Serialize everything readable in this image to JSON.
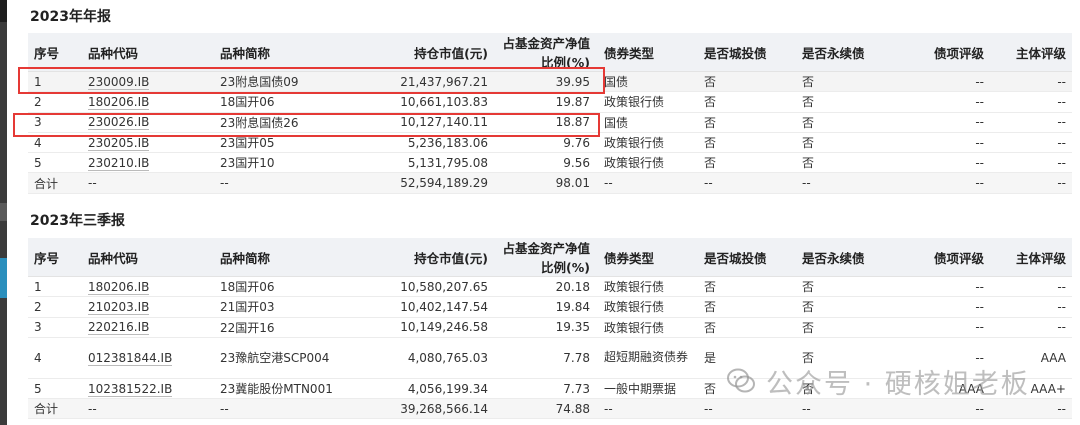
{
  "annual": {
    "title": "2023年年报",
    "headers": [
      "序号",
      "品种代码",
      "品种简称",
      "持仓市值(元)",
      "占基金资产净值比例(%)",
      "债券类型",
      "是否城投债",
      "是否永续债",
      "债项评级",
      "主体评级"
    ],
    "rows": [
      {
        "no": "1",
        "code": "230009.IB",
        "name": "23附息国债09",
        "value": "21,437,967.21",
        "pct": "39.95",
        "type": "国债",
        "city": "否",
        "perpetual": "否",
        "bond_rating": "--",
        "issuer_rating": "--"
      },
      {
        "no": "2",
        "code": "180206.IB",
        "name": "18国开06",
        "value": "10,661,103.83",
        "pct": "19.87",
        "type": "政策银行债",
        "city": "否",
        "perpetual": "否",
        "bond_rating": "--",
        "issuer_rating": "--"
      },
      {
        "no": "3",
        "code": "230026.IB",
        "name": "23附息国债26",
        "value": "10,127,140.11",
        "pct": "18.87",
        "type": "国债",
        "city": "否",
        "perpetual": "否",
        "bond_rating": "--",
        "issuer_rating": "--"
      },
      {
        "no": "4",
        "code": "230205.IB",
        "name": "23国开05",
        "value": "5,236,183.06",
        "pct": "9.76",
        "type": "政策银行债",
        "city": "否",
        "perpetual": "否",
        "bond_rating": "--",
        "issuer_rating": "--"
      },
      {
        "no": "5",
        "code": "230210.IB",
        "name": "23国开10",
        "value": "5,131,795.08",
        "pct": "9.56",
        "type": "政策银行债",
        "city": "否",
        "perpetual": "否",
        "bond_rating": "--",
        "issuer_rating": "--"
      }
    ],
    "total": {
      "no": "合计",
      "code": "--",
      "name": "--",
      "value": "52,594,189.29",
      "pct": "98.01",
      "type": "--",
      "city": "--",
      "perpetual": "--",
      "bond_rating": "--",
      "issuer_rating": "--"
    }
  },
  "q3": {
    "title": "2023年三季报",
    "headers": [
      "序号",
      "品种代码",
      "品种简称",
      "持仓市值(元)",
      "占基金资产净值比例(%)",
      "债券类型",
      "是否城投债",
      "是否永续债",
      "债项评级",
      "主体评级"
    ],
    "rows": [
      {
        "no": "1",
        "code": "180206.IB",
        "name": "18国开06",
        "value": "10,580,207.65",
        "pct": "20.18",
        "type": "政策银行债",
        "city": "否",
        "perpetual": "否",
        "bond_rating": "--",
        "issuer_rating": "--"
      },
      {
        "no": "2",
        "code": "210203.IB",
        "name": "21国开03",
        "value": "10,402,147.54",
        "pct": "19.84",
        "type": "政策银行债",
        "city": "否",
        "perpetual": "否",
        "bond_rating": "--",
        "issuer_rating": "--"
      },
      {
        "no": "3",
        "code": "220216.IB",
        "name": "22国开16",
        "value": "10,149,246.58",
        "pct": "19.35",
        "type": "政策银行债",
        "city": "否",
        "perpetual": "否",
        "bond_rating": "--",
        "issuer_rating": "--"
      },
      {
        "no": "4",
        "code": "012381844.IB",
        "name": "23豫航空港SCP004",
        "value": "4,080,765.03",
        "pct": "7.78",
        "type": "超短期融资债券",
        "city": "是",
        "perpetual": "否",
        "bond_rating": "--",
        "issuer_rating": "AAA"
      },
      {
        "no": "5",
        "code": "102381522.IB",
        "name": "23冀能股份MTN001",
        "value": "4,056,199.34",
        "pct": "7.73",
        "type": "一般中期票据",
        "city": "否",
        "perpetual": "否",
        "bond_rating": "AAA",
        "issuer_rating": "AAA+"
      }
    ],
    "total": {
      "no": "合计",
      "code": "--",
      "name": "--",
      "value": "39,268,566.14",
      "pct": "74.88",
      "type": "--",
      "city": "--",
      "perpetual": "--",
      "bond_rating": "--",
      "issuer_rating": "--"
    }
  },
  "watermark": {
    "text": "公众号 · 硬核姐老板",
    "icon": "wechat-icon"
  },
  "colors": {
    "highlight_border": "#e53935",
    "header_bg": "#f0f2f5",
    "sum_bg": "#f6f6f6"
  }
}
